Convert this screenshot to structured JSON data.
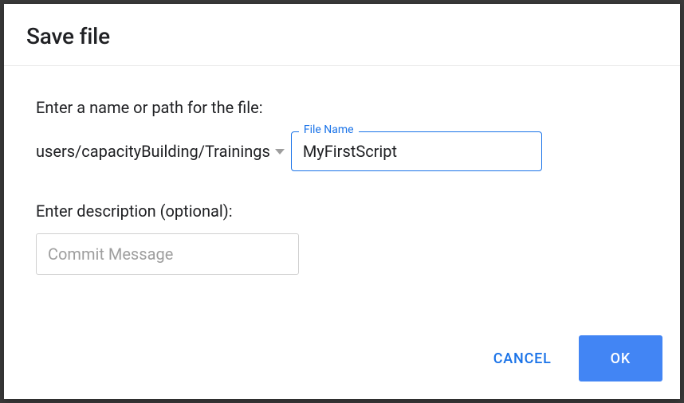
{
  "dialog": {
    "title": "Save file",
    "namePrompt": "Enter a name or path for the file:",
    "path": "users/capacityBuilding/Trainings",
    "fileNameLegend": "File Name",
    "fileNameValue": "MyFirstScript",
    "descPrompt": "Enter description (optional):",
    "descPlaceholder": "Commit Message",
    "cancelLabel": "CANCEL",
    "okLabel": "OK"
  }
}
